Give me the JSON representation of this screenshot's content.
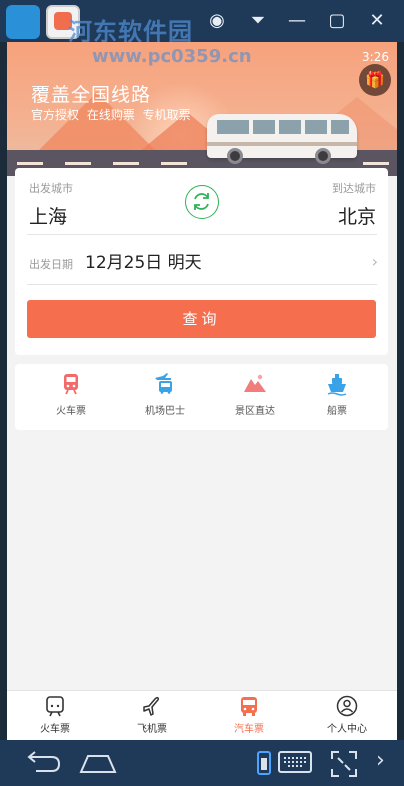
{
  "watermark": {
    "site": "河东软件园",
    "url": "www.pc0359.cn"
  },
  "status_bar": {
    "time": "3:26"
  },
  "banner": {
    "slogan": "覆盖全国线路",
    "sub_slogan": "官方授权  在线购票  专机取票"
  },
  "search": {
    "depart_label": "出发城市",
    "depart_city": "上海",
    "arrive_label": "到达城市",
    "arrive_city": "北京",
    "date_label": "出发日期",
    "date_value": "12月25日  明天",
    "query_label": "查询"
  },
  "categories": [
    {
      "label": "火车票",
      "icon": "train-icon",
      "color": "#f26a6a"
    },
    {
      "label": "机场巴士",
      "icon": "airport-bus-icon",
      "color": "#3aa3e8"
    },
    {
      "label": "景区直达",
      "icon": "scenic-mountain-icon",
      "color": "#f07c7c"
    },
    {
      "label": "船票",
      "icon": "ship-icon",
      "color": "#3aa3e8"
    }
  ],
  "bottom_nav": {
    "active": 2,
    "items": [
      {
        "label": "火车票",
        "icon": "train-front-icon"
      },
      {
        "label": "飞机票",
        "icon": "plane-icon"
      },
      {
        "label": "汽车票",
        "icon": "bus-icon"
      },
      {
        "label": "个人中心",
        "icon": "person-icon"
      }
    ]
  },
  "colors": {
    "accent": "#f56e4e",
    "swap_green": "#2fb257",
    "emulator_bar": "#1f3a58"
  }
}
